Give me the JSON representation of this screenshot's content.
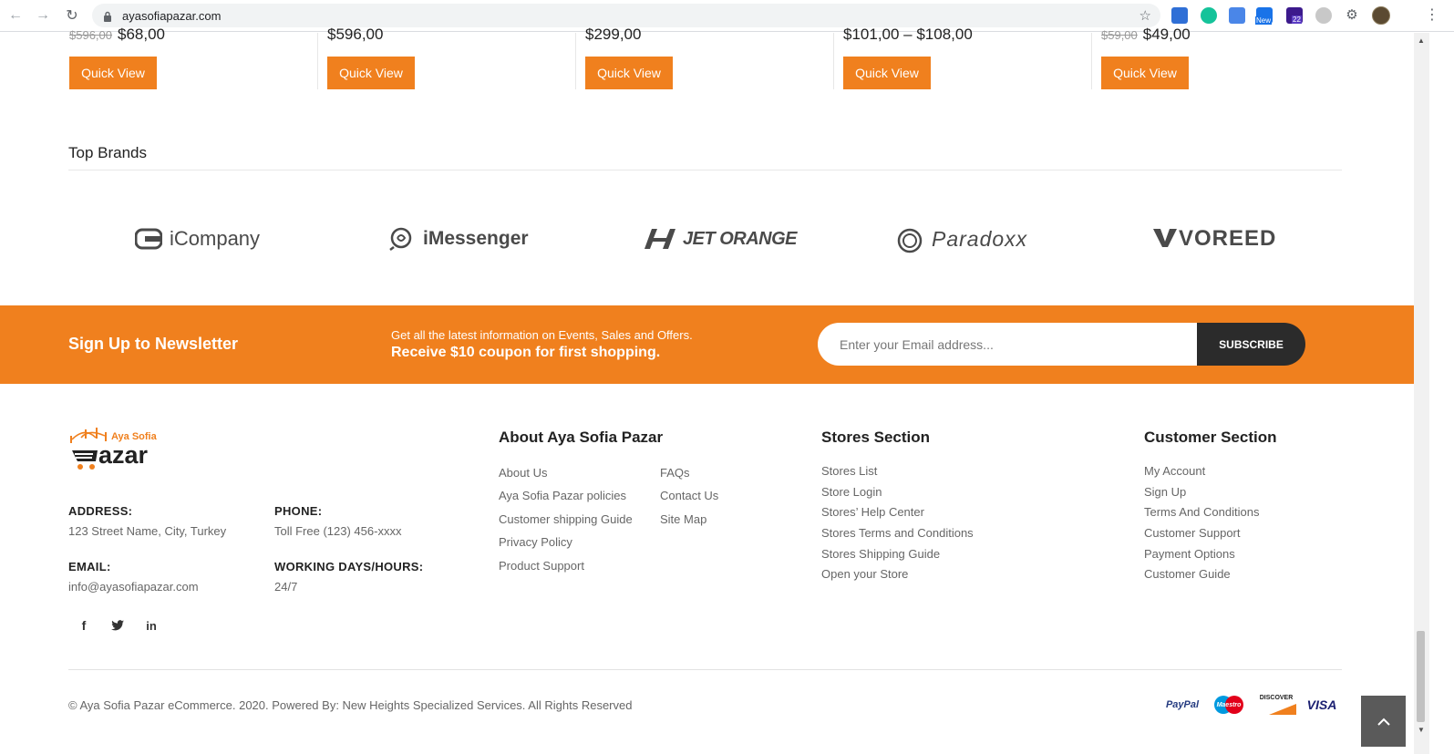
{
  "browser": {
    "url": "ayasofiapazar.com",
    "ext_badge_new": "New",
    "ext_badge_count": "22"
  },
  "products": [
    {
      "old_price": "$596,00",
      "price": "$68,00",
      "button": "Quick View"
    },
    {
      "old_price": "",
      "price": "$596,00",
      "button": "Quick View"
    },
    {
      "old_price": "",
      "price": "$299,00",
      "button": "Quick View"
    },
    {
      "old_price": "",
      "price": "$101,00 – $108,00",
      "button": "Quick View"
    },
    {
      "old_price": "$59,00",
      "price": "$49,00",
      "button": "Quick View"
    }
  ],
  "brands": {
    "title": "Top Brands",
    "items": [
      "iCompany",
      "iMessenger",
      "JET ORANGE",
      "Paradoxx",
      "VOREED"
    ]
  },
  "newsletter": {
    "title": "Sign Up to Newsletter",
    "line1": "Get all the latest information on Events, Sales and Offers.",
    "line2": "Receive $10 coupon for first shopping.",
    "placeholder": "Enter your Email address...",
    "button": "SUBSCRIBE"
  },
  "logo": {
    "top_text": "Aya Sofia",
    "main_text": "azar"
  },
  "contact": {
    "address_label": "ADDRESS:",
    "address": "123 Street Name, City, Turkey",
    "phone_label": "PHONE:",
    "phone": "Toll Free (123) 456-xxxx",
    "email_label": "EMAIL:",
    "email": "info@ayasofiapazar.com",
    "hours_label": "WORKING DAYS/HOURS:",
    "hours": "24/7"
  },
  "about": {
    "title": "About Aya Sofia Pazar",
    "col1": [
      "About Us",
      "Aya Sofia Pazar policies",
      "Customer shipping Guide",
      "Privacy Policy",
      "Product Support"
    ],
    "col2": [
      "FAQs",
      "Contact Us",
      "Site Map"
    ]
  },
  "stores": {
    "title": "Stores Section",
    "links": [
      "Stores List",
      "Store Login",
      "Stores’ Help Center",
      "Stores Terms and Conditions",
      "Stores Shipping Guide",
      "Open your Store"
    ]
  },
  "customer": {
    "title": "Customer Section",
    "links": [
      "My Account",
      "Sign Up",
      "Terms And Conditions",
      "Customer Support",
      "Payment Options",
      "Customer Guide"
    ]
  },
  "copyright": "© Aya Sofia Pazar eCommerce. 2020. Powered By: New Heights Specialized Services. All Rights Reserved",
  "payments": [
    "PayPal",
    "Maestro",
    "DISCOVER",
    "VISA"
  ],
  "colors": {
    "accent": "#f0801e",
    "dark": "#2b2b2b"
  }
}
